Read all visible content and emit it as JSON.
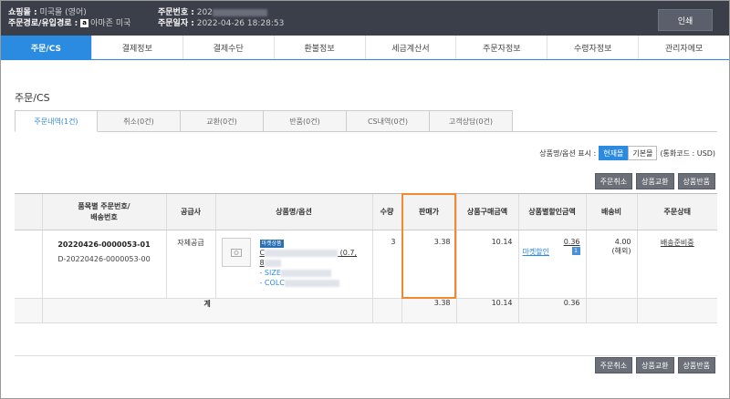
{
  "header": {
    "mall_label": "쇼핑몰 :",
    "mall_value": "미국몰 (영어)",
    "route_label": "주문경로/유입경로 :",
    "route_icon": "a",
    "route_value": "아마존 미국",
    "order_no_label": "주문번호 :",
    "order_no_value": "202",
    "order_date_label": "주문일자 :",
    "order_date_value": "2022-04-26 18:28:53",
    "print_button": "인쇄"
  },
  "nav_tabs": [
    {
      "label": "주문/CS"
    },
    {
      "label": "결제정보"
    },
    {
      "label": "결제수단"
    },
    {
      "label": "환불정보"
    },
    {
      "label": "세금계산서"
    },
    {
      "label": "주문자정보"
    },
    {
      "label": "수령자정보"
    },
    {
      "label": "관리자메모"
    }
  ],
  "section_title": "주문/CS",
  "sub_tabs": [
    {
      "label": "주문내역(1건)"
    },
    {
      "label": "취소(0건)"
    },
    {
      "label": "교환(0건)"
    },
    {
      "label": "반품(0건)"
    },
    {
      "label": "CS내역(0건)"
    },
    {
      "label": "고객상담(0건)"
    }
  ],
  "display": {
    "label": "상품명/옵션 표시 :",
    "opt_current": "현재몰",
    "opt_default": "기본몰",
    "currency": "(통화코드 : USD)"
  },
  "actions": {
    "cancel": "주문취소",
    "exchange": "상품교환",
    "return": "상품반품"
  },
  "table": {
    "headers": {
      "order": "품목별 주문번호/\n배송번호",
      "supplier": "공급사",
      "product": "상품명/옵션",
      "qty": "수량",
      "price": "판매가",
      "purchase": "상품구매금액",
      "discount": "상품별할인금액",
      "shipping": "배송비",
      "status": "주문상태"
    },
    "row": {
      "order_no": "20220426-0000053-01",
      "ship_no": "D-20220426-0000053-00",
      "supplier": "자체공급",
      "market_badge": "마켓상품",
      "name_start": "C",
      "name_tail": "(0.7,",
      "name_line2": "8",
      "opt_size": "- SIZE",
      "opt_color": "- COLC",
      "qty": "3",
      "price": "3.38",
      "purchase": "10.14",
      "discount": "0.36",
      "discount_link": "마켓할인",
      "discount_badge": "1",
      "shipping": "4.00",
      "shipping_note": "(해외)",
      "status": "배송준비중"
    },
    "total": {
      "label": "계",
      "price": "3.38",
      "purchase": "10.14",
      "discount": "0.36"
    }
  },
  "highlight_color": "#f08a2c",
  "accent_color": "#2b8be0"
}
